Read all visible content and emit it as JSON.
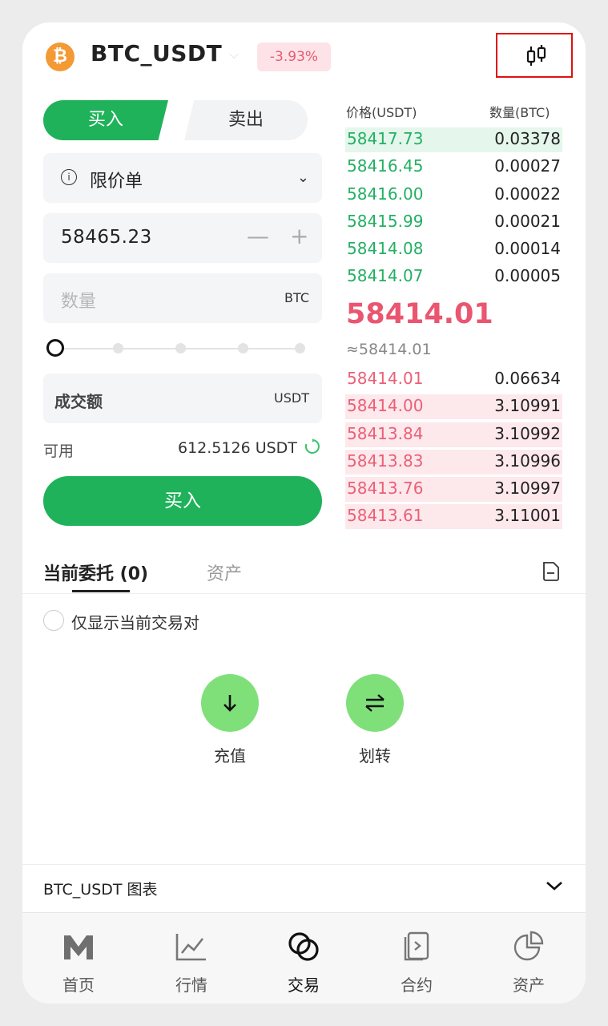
{
  "header": {
    "coin_symbol": "₿",
    "pair": "BTC_USDT",
    "change": "-3.93%",
    "kline_icon": "candlestick-chart-icon"
  },
  "trade_tabs": {
    "buy": "买入",
    "sell": "卖出"
  },
  "order_type": {
    "label": "限价单",
    "info_icon": "info-icon"
  },
  "price_input": {
    "value": "58465.23",
    "minus": "—",
    "plus": "+"
  },
  "qty_input": {
    "placeholder": "数量",
    "unit": "BTC"
  },
  "slider": {
    "level": 0
  },
  "total_input": {
    "label": "成交额",
    "unit": "USDT"
  },
  "available": {
    "label": "可用",
    "value": "612.5126 USDT"
  },
  "buy_button": "买入",
  "orderbook": {
    "price_header": "价格(USDT)",
    "qty_header": "数量(BTC)",
    "asks": [
      {
        "price": "58417.73",
        "qty": "0.03378",
        "depth": 1.0
      },
      {
        "price": "58416.45",
        "qty": "0.00027",
        "depth": 0
      },
      {
        "price": "58416.00",
        "qty": "0.00022",
        "depth": 0
      },
      {
        "price": "58415.99",
        "qty": "0.00021",
        "depth": 0
      },
      {
        "price": "58414.08",
        "qty": "0.00014",
        "depth": 0
      },
      {
        "price": "58414.07",
        "qty": "0.00005",
        "depth": 0
      }
    ],
    "last_price": "58414.01",
    "last_price_approx": "≈58414.01",
    "bids": [
      {
        "price": "58414.01",
        "qty": "0.06634",
        "depth": 0
      },
      {
        "price": "58414.00",
        "qty": "3.10991",
        "depth": 1.0
      },
      {
        "price": "58413.84",
        "qty": "3.10992",
        "depth": 1.0
      },
      {
        "price": "58413.83",
        "qty": "3.10996",
        "depth": 1.0
      },
      {
        "price": "58413.76",
        "qty": "3.10997",
        "depth": 1.0
      },
      {
        "price": "58413.61",
        "qty": "3.11001",
        "depth": 1.0
      }
    ]
  },
  "sections": {
    "orders": "当前委托 (0)",
    "assets": "资产"
  },
  "filter": {
    "only_current_pair": "仅显示当前交易对"
  },
  "actions": {
    "deposit": "充值",
    "transfer": "划转"
  },
  "chart_bar": {
    "label": "BTC_USDT 图表"
  },
  "nav": [
    {
      "label": "首页",
      "icon": "home-m-icon"
    },
    {
      "label": "行情",
      "icon": "market-chart-icon"
    },
    {
      "label": "交易",
      "icon": "trade-circles-icon"
    },
    {
      "label": "合约",
      "icon": "contract-doc-icon"
    },
    {
      "label": "资产",
      "icon": "assets-pie-icon"
    }
  ],
  "colors": {
    "green": "#1fb25a",
    "red": "#ea6077",
    "ask_bg": "#e5f7ec",
    "bid_bg": "#fde8ec"
  }
}
